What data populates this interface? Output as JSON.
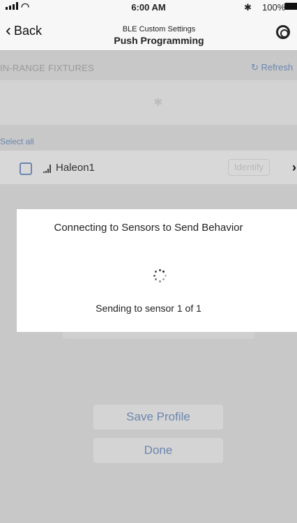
{
  "status_bar": {
    "time": "6:00 AM",
    "battery": "100%",
    "bluetooth_glyph": "✱"
  },
  "nav": {
    "back_label": "Back",
    "back_icon": "chevron-left-icon",
    "subtitle": "BLE Custom Settings",
    "title": "Push Programming",
    "help_icon": "lifebuoy-icon"
  },
  "section": {
    "header": "IN-RANGE FIXTURES",
    "refresh_label": "Refresh",
    "refresh_icon": "refresh-icon"
  },
  "select_all_label": "Select all",
  "fixtures": [
    {
      "name": "Haleon1",
      "identify_label": "Identify"
    }
  ],
  "modal": {
    "title": "Connecting to Sensors to Send Behavior",
    "status": "Sending to sensor 1 of 1"
  },
  "buttons": {
    "save_profile": "Save Profile",
    "done": "Done"
  },
  "colors": {
    "accent": "#6b86b0",
    "overlay": "#c8c8c8",
    "modal": "#ffffff"
  }
}
